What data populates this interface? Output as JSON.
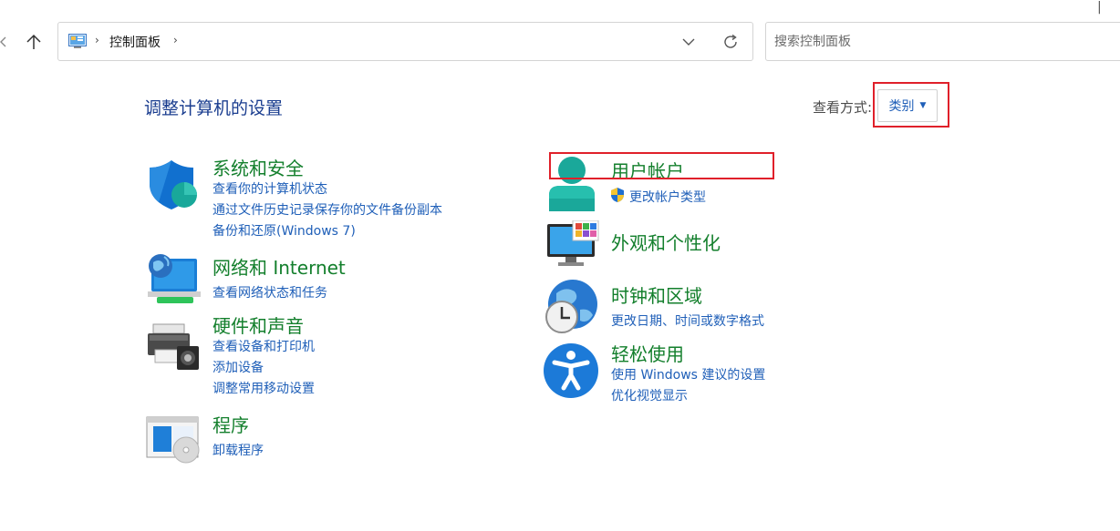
{
  "address": {
    "breadcrumb": "控制面板",
    "separator": "›"
  },
  "search": {
    "placeholder": "搜索控制面板"
  },
  "header": {
    "title": "调整计算机的设置",
    "view_label": "查看方式:",
    "view_value": "类别"
  },
  "categories": {
    "security": {
      "title": "系统和安全",
      "links": [
        "查看你的计算机状态",
        "通过文件历史记录保存你的文件备份副本",
        "备份和还原(Windows 7)"
      ]
    },
    "network": {
      "title": "网络和 Internet",
      "links": [
        "查看网络状态和任务"
      ]
    },
    "hardware": {
      "title": "硬件和声音",
      "links": [
        "查看设备和打印机",
        "添加设备",
        "调整常用移动设置"
      ]
    },
    "programs": {
      "title": "程序",
      "links": [
        "卸载程序"
      ]
    },
    "users": {
      "title": "用户帐户",
      "links": [
        "更改帐户类型"
      ]
    },
    "appearance": {
      "title": "外观和个性化",
      "links": []
    },
    "clock": {
      "title": "时钟和区域",
      "links": [
        "更改日期、时间或数字格式"
      ]
    },
    "ease": {
      "title": "轻松使用",
      "links": [
        "使用 Windows 建议的设置",
        "优化视觉显示"
      ]
    }
  },
  "colors": {
    "category_title": "#137f2c",
    "link": "#1f5fb8",
    "page_title": "#1a3d8f",
    "highlight": "#e0202a"
  },
  "icons": {
    "back": "chevron-left-icon",
    "up": "arrow-up-icon",
    "location": "control-panel-icon",
    "dropdown": "chevron-down-icon",
    "refresh": "refresh-icon",
    "shield": "shield-icon",
    "uac": "uac-shield-icon"
  }
}
